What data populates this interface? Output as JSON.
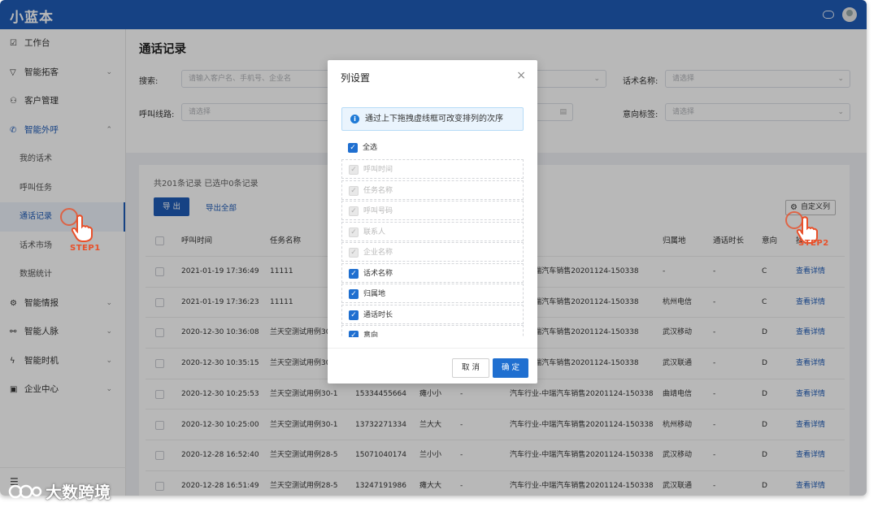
{
  "app": {
    "logo": "小蓝本"
  },
  "sidebar": {
    "items": [
      {
        "icon": "workbench-icon",
        "glyph": "☑",
        "label": "工作台"
      },
      {
        "icon": "funnel-icon",
        "glyph": "▽",
        "label": "智能拓客",
        "arrow": "⌄"
      },
      {
        "icon": "customer-icon",
        "glyph": "⚇",
        "label": "客户管理"
      },
      {
        "icon": "phone-icon",
        "glyph": "✆",
        "label": "智能外呼",
        "arrow": "⌃"
      }
    ],
    "sub_items": [
      "我的话术",
      "呼叫任务",
      "通话记录",
      "话术市场",
      "数据统计"
    ],
    "items2": [
      {
        "icon": "intel-icon",
        "glyph": "⚙",
        "label": "智能情报",
        "arrow": "⌄"
      },
      {
        "icon": "network-icon",
        "glyph": "⚯",
        "label": "智能人脉",
        "arrow": "⌄"
      },
      {
        "icon": "opportunity-icon",
        "glyph": "ϟ",
        "label": "智能时机",
        "arrow": "⌄"
      },
      {
        "icon": "enterprise-icon",
        "glyph": "▣",
        "label": "企业中心",
        "arrow": "⌄"
      }
    ],
    "collapse": "☰"
  },
  "page": {
    "title": "通话记录"
  },
  "filters": {
    "search_label": "搜索:",
    "search_placeholder": "请输入客户名、手机号、企业名",
    "script_label": "话术名称:",
    "script_placeholder": "请选择",
    "line_label": "呼叫线路:",
    "line_placeholder": "请选择",
    "intent_label": "意向标签:",
    "intent_placeholder": "请选择"
  },
  "table": {
    "stats": "共201条记录 已选中0条记录",
    "export_label": "导 出",
    "export_all_label": "导出全部",
    "custom_columns_label": "自定义列",
    "headers": [
      "呼叫时间",
      "任务名称",
      "",
      "",
      "",
      "",
      "归属地",
      "通话时长",
      "意向",
      "操作"
    ],
    "rows": [
      [
        "2021-01-19 17:36:49",
        "11111",
        "",
        "",
        "",
        "行业-中瑞汽车销售20201124-150338",
        "-",
        "-",
        "C",
        "查看详情"
      ],
      [
        "2021-01-19 17:36:23",
        "11111",
        "",
        "",
        "",
        "行业-中瑞汽车销售20201124-150338",
        "杭州电信",
        "-",
        "C",
        "查看详情"
      ],
      [
        "2020-12-30 10:36:08",
        "兰天空测试用例30-",
        "",
        "",
        "",
        "行业-中瑞汽车销售20201124-150338",
        "武汉移动",
        "-",
        "D",
        "查看详情"
      ],
      [
        "2020-12-30 10:35:15",
        "兰天空测试用例30-",
        "",
        "",
        "",
        "行业-中瑞汽车销售20201124-150338",
        "武汉联通",
        "-",
        "D",
        "查看详情"
      ],
      [
        "2020-12-30 10:25:53",
        "兰天空测试用例30-1",
        "15334455664",
        "瘫小小",
        "-",
        "汽车行业-中瑞汽车销售20201124-150338",
        "曲靖电信",
        "-",
        "D",
        "查看详情"
      ],
      [
        "2020-12-30 10:25:00",
        "兰天空测试用例30-1",
        "13732271334",
        "兰大大",
        "-",
        "汽车行业-中瑞汽车销售20201124-150338",
        "杭州移动",
        "-",
        "D",
        "查看详情"
      ],
      [
        "2020-12-28 16:52:40",
        "兰天空测试用例28-5",
        "15071040174",
        "兰小小",
        "-",
        "汽车行业-中瑞汽车销售20201124-150338",
        "武汉移动",
        "-",
        "D",
        "查看详情"
      ],
      [
        "2020-12-28 16:51:49",
        "兰天空测试用例28-5",
        "13247191986",
        "瘫大大",
        "-",
        "汽车行业-中瑞汽车销售20201124-150338",
        "武汉联通",
        "-",
        "D",
        "查看详情"
      ]
    ]
  },
  "modal": {
    "title": "列设置",
    "close": "×",
    "tip": "通过上下拖拽虚线框可改变排列的次序",
    "select_all": "全选",
    "columns": [
      {
        "label": "呼叫时间",
        "disabled": true
      },
      {
        "label": "任务名称",
        "disabled": true
      },
      {
        "label": "呼叫号码",
        "disabled": true
      },
      {
        "label": "联系人",
        "disabled": true
      },
      {
        "label": "企业名称",
        "disabled": true
      },
      {
        "label": "话术名称",
        "disabled": false
      },
      {
        "label": "归属地",
        "disabled": false
      },
      {
        "label": "通话时长",
        "disabled": false
      },
      {
        "label": "意向",
        "disabled": false
      }
    ],
    "cancel_label": "取 消",
    "ok_label": "确 定"
  },
  "annotations": {
    "step": "STEP"
  },
  "watermark": {
    "text": "大数跨境"
  },
  "colors": {
    "primary": "#1f5cb8",
    "accent": "#e8502a"
  }
}
